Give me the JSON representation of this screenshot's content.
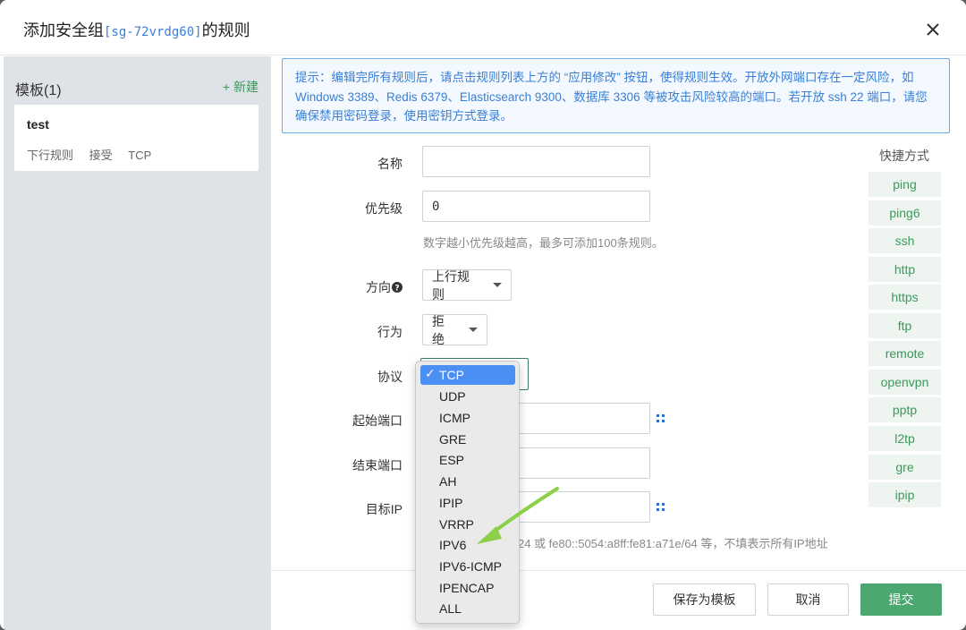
{
  "dialog": {
    "title_prefix": "添加安全组",
    "title_code": "[sg-72vrdg60]",
    "title_suffix": "的规则"
  },
  "sidebar": {
    "heading": "模板(1)",
    "new_label": "+ 新建",
    "templates": [
      {
        "name": "test",
        "direction": "下行规则",
        "action": "接受",
        "protocol": "TCP"
      }
    ]
  },
  "notice": {
    "text": "提示：编辑完所有规则后，请点击规则列表上方的 “应用修改” 按钮，使得规则生效。开放外网端口存在一定风险，如 Windows 3389、Redis 6379、Elasticsearch 9300、数据库 3306 等被攻击风险较高的端口。若开放 ssh 22 端口，请您确保禁用密码登录，使用密钥方式登录。"
  },
  "form": {
    "name_label": "名称",
    "name_value": "",
    "priority_label": "优先级",
    "priority_value": "0",
    "priority_help": "数字越小优先级越高，最多可添加100条规则。",
    "direction_label": "方向",
    "direction_value": "上行规则",
    "action_label": "行为",
    "action_value": "拒绝",
    "protocol_label": "协议",
    "start_port_label": "起始端口",
    "end_port_label": "结束端口",
    "target_ip_label": "目标IP",
    "target_ip_help": "24 或 fe80::5054:a8ff:fe81:a71e/64 等，不填表示所有IP地址"
  },
  "protocol_dropdown": {
    "selected": "TCP",
    "options": [
      "TCP",
      "UDP",
      "ICMP",
      "GRE",
      "ESP",
      "AH",
      "IPIP",
      "VRRP",
      "IPV6",
      "IPV6-ICMP",
      "IPENCAP",
      "ALL"
    ]
  },
  "quick_settings": {
    "title": "快捷方式",
    "items": [
      "ping",
      "ping6",
      "ssh",
      "http",
      "https",
      "ftp",
      "remote",
      "openvpn",
      "pptp",
      "l2tp",
      "gre",
      "ipip"
    ]
  },
  "footer": {
    "save_template": "保存为模板",
    "cancel": "取消",
    "submit": "提交"
  },
  "colors": {
    "accent_green": "#4aa870",
    "link_blue": "#3a7fd5",
    "arrow_green": "#8cd04a",
    "selection_blue": "#4b8ff2"
  }
}
